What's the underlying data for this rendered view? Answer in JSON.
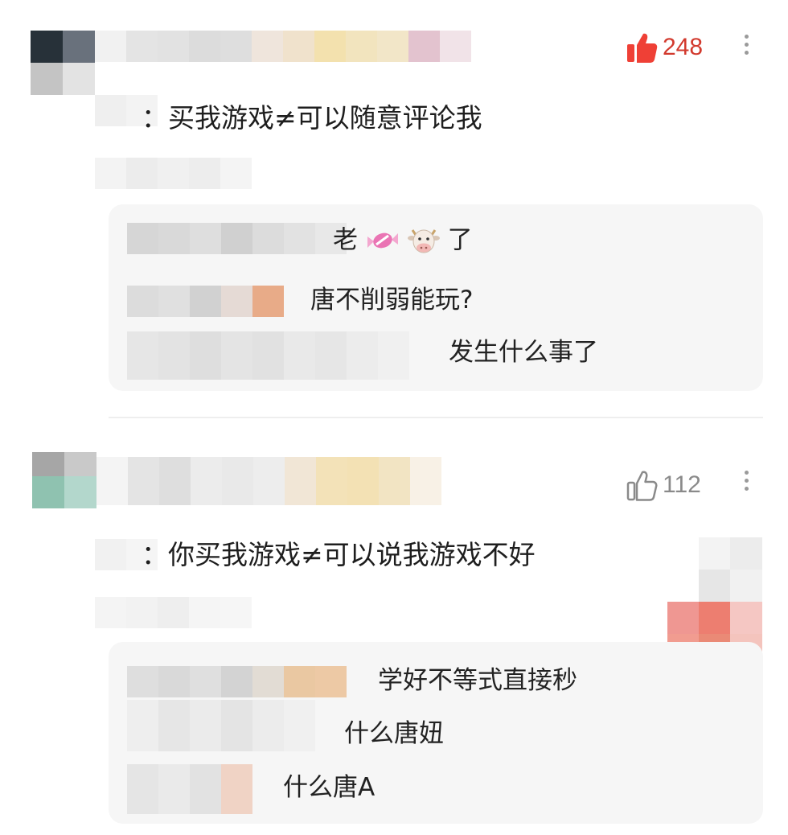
{
  "comments": [
    {
      "like_count": "248",
      "liked": true,
      "text": "：买我游戏≠可以随意评论我",
      "replies": [
        {
          "text_before": "老",
          "text_after": "了",
          "emoji_names": [
            "candy-emoji",
            "cow-face-emoji"
          ]
        },
        {
          "text": "唐不削弱能玩?"
        },
        {
          "text": "发生什么事了"
        }
      ]
    },
    {
      "like_count": "112",
      "liked": false,
      "text": "：你买我游戏≠可以说我游戏不好",
      "replies": [
        {
          "text": "学好不等式直接秒"
        },
        {
          "text": "什么唐妞"
        },
        {
          "text": "什么唐A"
        }
      ]
    }
  ],
  "colors": {
    "liked_red": "#ef4036",
    "like_count_red": "#d23a2e",
    "like_count_gray": "#8a8a8a",
    "reply_bg": "#f6f6f6"
  }
}
